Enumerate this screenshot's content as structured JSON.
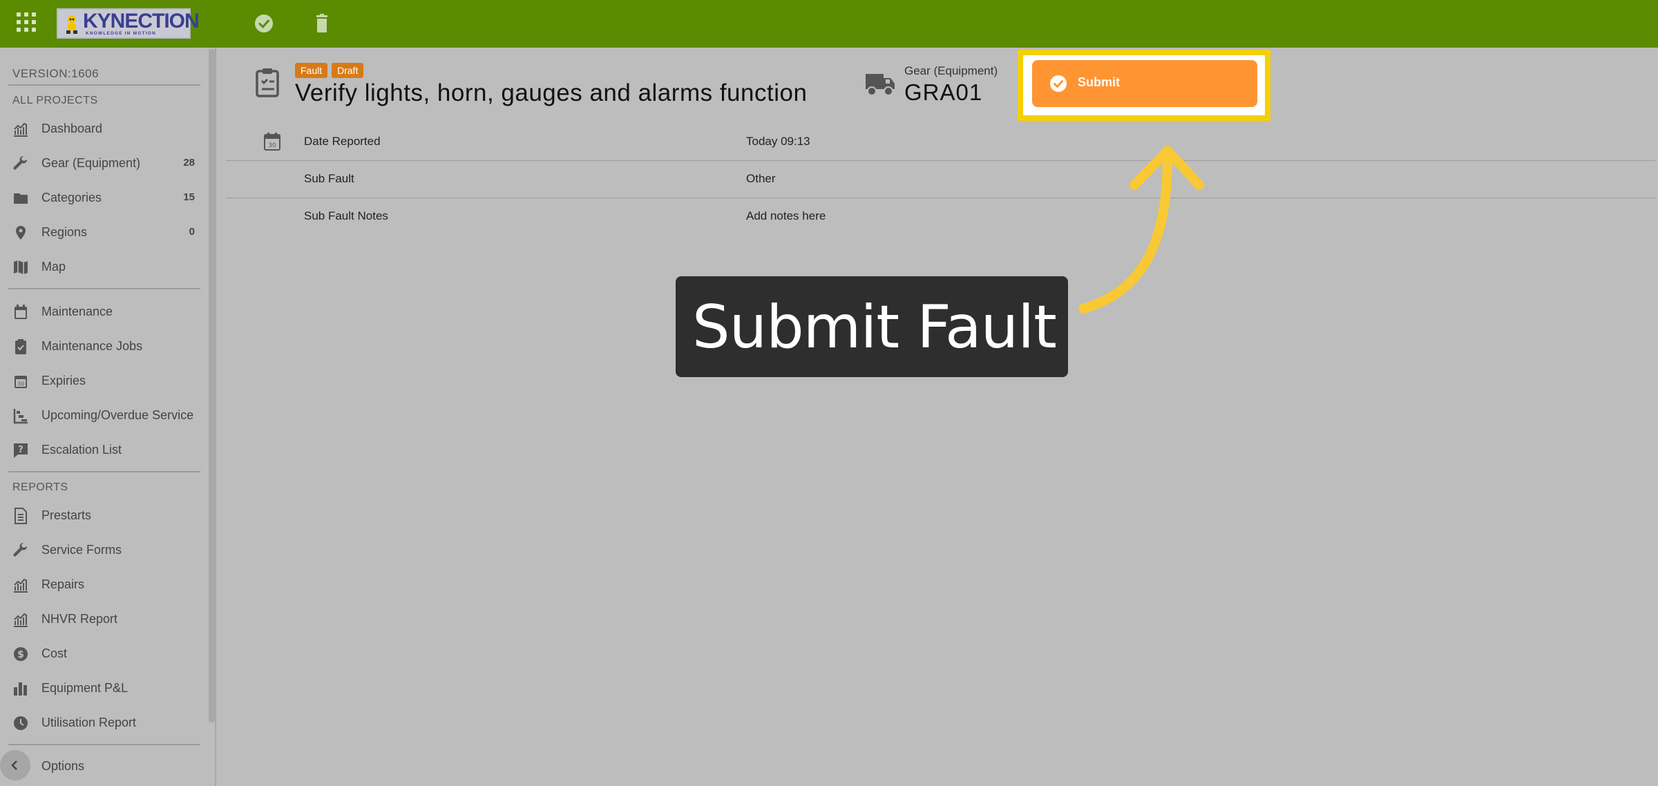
{
  "topbar": {
    "logo_text": "KYNECTION",
    "logo_tagline": "KNOWLEDGE IN MOTION",
    "icons": [
      "apps-icon",
      "check-circle-icon",
      "trash-icon"
    ]
  },
  "sidebar": {
    "version": "VERSION:1606",
    "sections": {
      "all_projects": "ALL PROJECTS",
      "reports": "REPORTS"
    },
    "items": [
      {
        "label": "Dashboard",
        "count": "",
        "icon": "bar-chart-icon"
      },
      {
        "label": "Gear (Equipment)",
        "count": "28",
        "icon": "wrench-icon"
      },
      {
        "label": "Categories",
        "count": "15",
        "icon": "folder-icon"
      },
      {
        "label": "Regions",
        "count": "0",
        "icon": "map-pin-icon"
      },
      {
        "label": "Map",
        "count": "",
        "icon": "map-icon"
      },
      {
        "label": "Maintenance",
        "count": "",
        "icon": "calendar-icon"
      },
      {
        "label": "Maintenance Jobs",
        "count": "",
        "icon": "clipboard-check-icon"
      },
      {
        "label": "Expiries",
        "count": "",
        "icon": "calendar-30-icon"
      },
      {
        "label": "Upcoming/Overdue Service",
        "count": "",
        "icon": "timeline-icon"
      },
      {
        "label": "Escalation List",
        "count": "",
        "icon": "question-box-icon"
      }
    ],
    "report_items": [
      {
        "label": "Prestarts",
        "icon": "document-icon"
      },
      {
        "label": "Service Forms",
        "icon": "wrench-icon"
      },
      {
        "label": "Repairs",
        "icon": "bar-chart-icon"
      },
      {
        "label": "NHVR Report",
        "icon": "bar-chart-icon"
      },
      {
        "label": "Cost",
        "icon": "dollar-circle-icon"
      },
      {
        "label": "Equipment P&L",
        "icon": "bar-chart-solid-icon"
      },
      {
        "label": "Utilisation Report",
        "icon": "clock-icon"
      }
    ],
    "options_label": "Options"
  },
  "header": {
    "badges": [
      "Fault",
      "Draft"
    ],
    "title": "Verify lights, horn, gauges and alarms function",
    "gear_label": "Gear (Equipment)",
    "gear_value": "GRA01",
    "submit_label": "Submit"
  },
  "details": [
    {
      "key": "Date Reported",
      "value": "Today 09:13"
    },
    {
      "key": "Sub Fault",
      "value": "Other"
    },
    {
      "key": "Sub Fault Notes",
      "value": "Add notes here"
    }
  ],
  "callout": {
    "text": "Submit Fault"
  },
  "colors": {
    "topbar": "#5b8b00",
    "submit": "#ff9433",
    "highlight": "#f5d000",
    "badge": "#d87a16",
    "arrow": "#f9c934"
  }
}
